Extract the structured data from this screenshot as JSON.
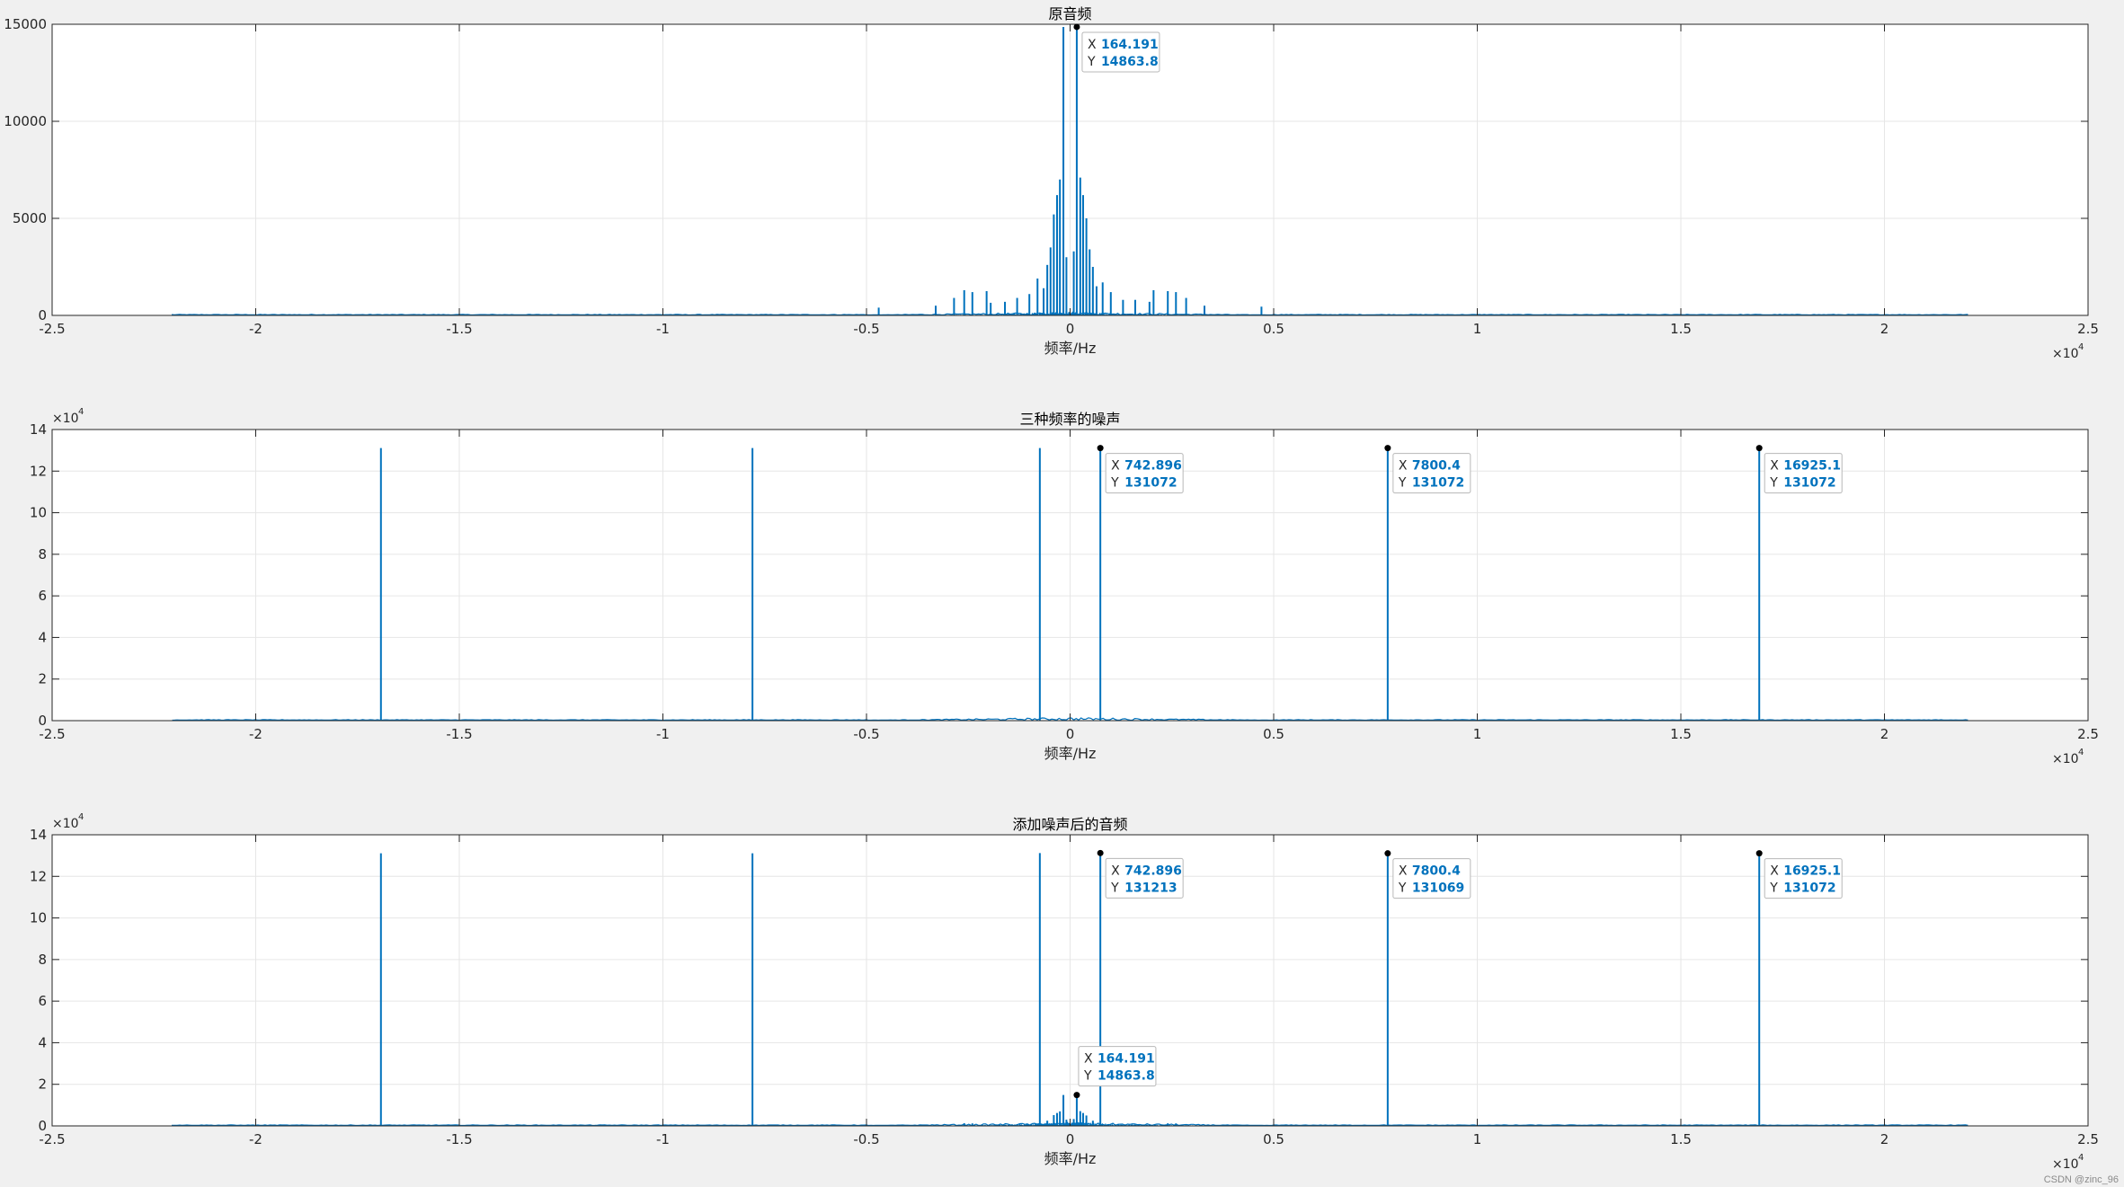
{
  "watermark": "CSDN @zinc_96",
  "colors": {
    "series": "#0072bd",
    "grid": "#e6e6e6",
    "axes_bg": "#ffffff",
    "page_bg": "#f0f0f0"
  },
  "chart_data": [
    {
      "type": "line",
      "title": "原音频",
      "xlabel": "频率/Hz",
      "ylabel": "",
      "x_exponent": "×10",
      "x_exponent_power": "4",
      "y_exponent": "",
      "y_exponent_power": "",
      "xlim": [
        -25000,
        25000
      ],
      "ylim": [
        0,
        15000
      ],
      "x_ticks": [
        -25000,
        -20000,
        -15000,
        -10000,
        -5000,
        0,
        5000,
        10000,
        15000,
        20000,
        25000
      ],
      "x_tick_labels": [
        "-2.5",
        "-2",
        "-1.5",
        "-1",
        "-0.5",
        "0",
        "0.5",
        "1",
        "1.5",
        "2",
        "2.5"
      ],
      "y_ticks": [
        0,
        5000,
        10000,
        15000
      ],
      "y_tick_labels": [
        "0",
        "5000",
        "10000",
        "15000"
      ],
      "grid": true,
      "data_range": [
        -22050,
        22050
      ],
      "spikes": [
        {
          "x": -164.191,
          "y": 14863.8
        },
        {
          "x": 164.191,
          "y": 14863.8
        },
        {
          "x": -320,
          "y": 6200
        },
        {
          "x": 320,
          "y": 6200
        },
        {
          "x": -250,
          "y": 7000
        },
        {
          "x": 250,
          "y": 7100
        },
        {
          "x": -400,
          "y": 5200
        },
        {
          "x": 400,
          "y": 5000
        },
        {
          "x": -480,
          "y": 3500
        },
        {
          "x": 480,
          "y": 3400
        },
        {
          "x": -560,
          "y": 2600
        },
        {
          "x": 560,
          "y": 2500
        },
        {
          "x": -90,
          "y": 3000
        },
        {
          "x": 90,
          "y": 3300
        },
        {
          "x": -650,
          "y": 1400
        },
        {
          "x": 650,
          "y": 1500
        },
        {
          "x": -800,
          "y": 1900
        },
        {
          "x": 800,
          "y": 1700
        },
        {
          "x": -1000,
          "y": 1100
        },
        {
          "x": 1000,
          "y": 1200
        },
        {
          "x": -1300,
          "y": 900
        },
        {
          "x": 1300,
          "y": 800
        },
        {
          "x": -1600,
          "y": 700
        },
        {
          "x": 1600,
          "y": 800
        },
        {
          "x": -1950,
          "y": 650
        },
        {
          "x": 1950,
          "y": 700
        },
        {
          "x": -2050,
          "y": 1250
        },
        {
          "x": 2050,
          "y": 1300
        },
        {
          "x": -2400,
          "y": 1200
        },
        {
          "x": 2400,
          "y": 1250
        },
        {
          "x": -2600,
          "y": 1300
        },
        {
          "x": 2600,
          "y": 1200
        },
        {
          "x": -2850,
          "y": 900
        },
        {
          "x": 2850,
          "y": 900
        },
        {
          "x": -3300,
          "y": 500
        },
        {
          "x": 3300,
          "y": 500
        },
        {
          "x": -4700,
          "y": 400
        },
        {
          "x": 4700,
          "y": 450
        }
      ],
      "tooltips": [
        {
          "x": 164.191,
          "y": 14863.8,
          "x_label": "164.191",
          "y_label": "14863.8"
        }
      ]
    },
    {
      "type": "line",
      "title": "三种频率的噪声",
      "xlabel": "频率/Hz",
      "ylabel": "",
      "x_exponent": "×10",
      "x_exponent_power": "4",
      "y_exponent": "×10",
      "y_exponent_power": "4",
      "xlim": [
        -25000,
        25000
      ],
      "ylim": [
        0,
        140000
      ],
      "x_ticks": [
        -25000,
        -20000,
        -15000,
        -10000,
        -5000,
        0,
        5000,
        10000,
        15000,
        20000,
        25000
      ],
      "x_tick_labels": [
        "-2.5",
        "-2",
        "-1.5",
        "-1",
        "-0.5",
        "0",
        "0.5",
        "1",
        "1.5",
        "2",
        "2.5"
      ],
      "y_ticks": [
        0,
        20000,
        40000,
        60000,
        80000,
        100000,
        120000,
        140000
      ],
      "y_tick_labels": [
        "0",
        "2",
        "4",
        "6",
        "8",
        "10",
        "12",
        "14"
      ],
      "grid": true,
      "data_range": [
        -22050,
        22050
      ],
      "spikes": [
        {
          "x": -16925.1,
          "y": 131072
        },
        {
          "x": -7800.4,
          "y": 131072
        },
        {
          "x": -742.896,
          "y": 131072
        },
        {
          "x": 742.896,
          "y": 131072
        },
        {
          "x": 7800.4,
          "y": 131072
        },
        {
          "x": 16925.1,
          "y": 131072
        }
      ],
      "tooltips": [
        {
          "x": 742.896,
          "y": 131072,
          "x_label": "742.896",
          "y_label": "131072"
        },
        {
          "x": 7800.4,
          "y": 131072,
          "x_label": "7800.4",
          "y_label": "131072"
        },
        {
          "x": 16925.1,
          "y": 131072,
          "x_label": "16925.1",
          "y_label": "131072"
        }
      ]
    },
    {
      "type": "line",
      "title": "添加噪声后的音频",
      "xlabel": "频率/Hz",
      "ylabel": "",
      "x_exponent": "×10",
      "x_exponent_power": "4",
      "y_exponent": "×10",
      "y_exponent_power": "4",
      "xlim": [
        -25000,
        25000
      ],
      "ylim": [
        0,
        140000
      ],
      "x_ticks": [
        -25000,
        -20000,
        -15000,
        -10000,
        -5000,
        0,
        5000,
        10000,
        15000,
        20000,
        25000
      ],
      "x_tick_labels": [
        "-2.5",
        "-2",
        "-1.5",
        "-1",
        "-0.5",
        "0",
        "0.5",
        "1",
        "1.5",
        "2",
        "2.5"
      ],
      "y_ticks": [
        0,
        20000,
        40000,
        60000,
        80000,
        100000,
        120000,
        140000
      ],
      "y_tick_labels": [
        "0",
        "2",
        "4",
        "6",
        "8",
        "10",
        "12",
        "14"
      ],
      "grid": true,
      "data_range": [
        -22050,
        22050
      ],
      "spikes": [
        {
          "x": -16925.1,
          "y": 131072
        },
        {
          "x": -7800.4,
          "y": 131069
        },
        {
          "x": -742.896,
          "y": 131213
        },
        {
          "x": 742.896,
          "y": 131213
        },
        {
          "x": 7800.4,
          "y": 131069
        },
        {
          "x": 16925.1,
          "y": 131072
        },
        {
          "x": -164.191,
          "y": 14863.8
        },
        {
          "x": 164.191,
          "y": 14863.8
        },
        {
          "x": -250,
          "y": 7000
        },
        {
          "x": 250,
          "y": 7100
        },
        {
          "x": -320,
          "y": 6200
        },
        {
          "x": 320,
          "y": 6200
        },
        {
          "x": -400,
          "y": 5200
        },
        {
          "x": 400,
          "y": 5000
        },
        {
          "x": -90,
          "y": 3000
        },
        {
          "x": 90,
          "y": 3300
        },
        {
          "x": -560,
          "y": 2500
        },
        {
          "x": 560,
          "y": 2500
        },
        {
          "x": -2400,
          "y": 1200
        },
        {
          "x": 2400,
          "y": 1250
        },
        {
          "x": -2600,
          "y": 1300
        },
        {
          "x": 2600,
          "y": 1200
        }
      ],
      "tooltips": [
        {
          "x": 742.896,
          "y": 131213,
          "x_label": "742.896",
          "y_label": "131213"
        },
        {
          "x": 7800.4,
          "y": 131069,
          "x_label": "7800.4",
          "y_label": "131069"
        },
        {
          "x": 16925.1,
          "y": 131072,
          "x_label": "16925.1",
          "y_label": "131072"
        },
        {
          "x": 164.191,
          "y": 14863.8,
          "x_label": "164.191",
          "y_label": "14863.8",
          "above": true
        }
      ]
    }
  ]
}
